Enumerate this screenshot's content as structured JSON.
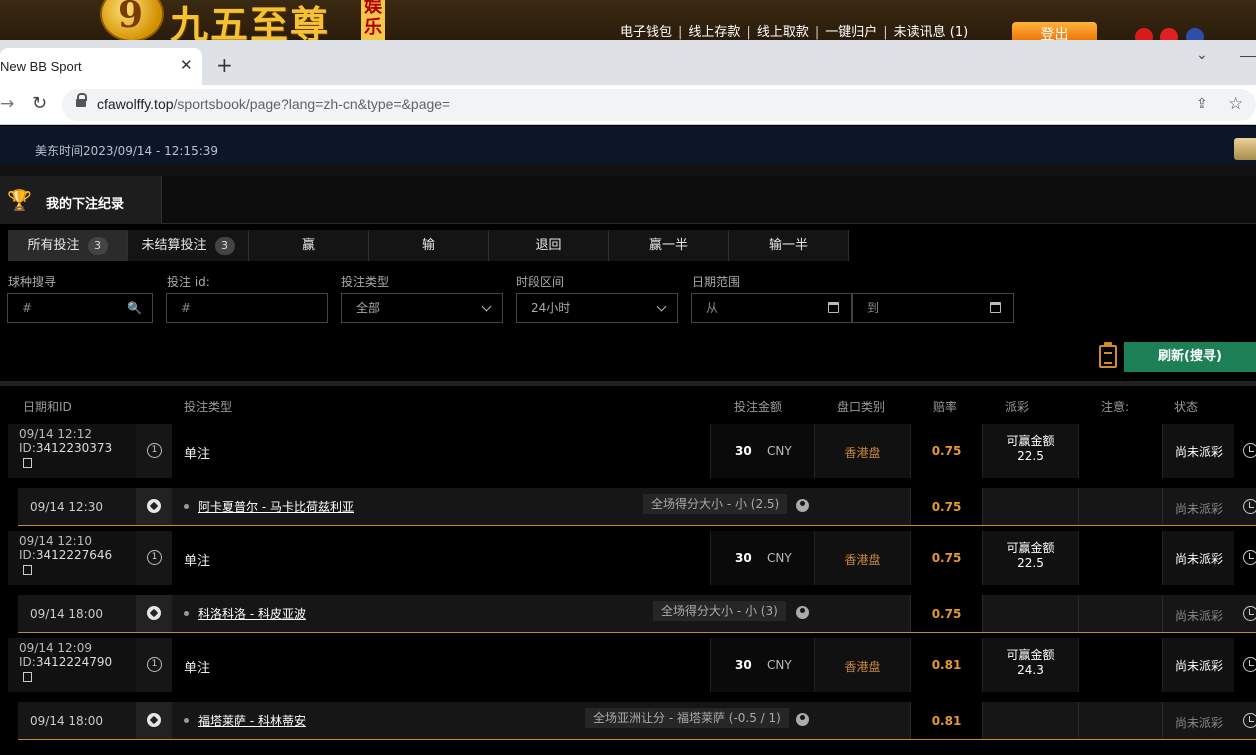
{
  "site": {
    "logo_text": "九五至尊",
    "logo_tag": "娱乐",
    "logo_badge": "9",
    "top_links": [
      "电子钱包",
      "线上存款",
      "线上取款",
      "一键归户",
      "未读讯息 (1)"
    ],
    "logout_label": "登出"
  },
  "browser": {
    "tab_title": "New BB Sport",
    "url_host": "cfawolffy.top",
    "url_path": "/sportsbook/page?lang=zh-cn&type=&page="
  },
  "page": {
    "time_label": "美东时间2023/09/14 - 12:15:39",
    "title": "我的下注纪录",
    "filter_tabs": [
      {
        "label": "所有投注",
        "count": "3"
      },
      {
        "label": "未结算投注",
        "count": "3"
      },
      {
        "label": "赢"
      },
      {
        "label": "输"
      },
      {
        "label": "退回"
      },
      {
        "label": "赢一半"
      },
      {
        "label": "输一半"
      }
    ],
    "filters": {
      "sport_label": "球种搜寻",
      "sport_placeholder": "#",
      "betid_label": "投注 id:",
      "betid_placeholder": "#",
      "bettype_label": "投注类型",
      "bettype_value": "全部",
      "period_label": "时段区间",
      "period_value": "24小时",
      "date_label": "日期范围",
      "date_from": "从",
      "date_to": "到"
    },
    "refresh_label": "刷新(搜寻)",
    "columns": [
      "日期和ID",
      "投注类型",
      "投注金额",
      "盘口类别",
      "赔率",
      "派彩",
      "注意:",
      "状态"
    ]
  },
  "bets": [
    {
      "date": "09/14 12:12",
      "id_prefix": "ID:",
      "id": "3412230373",
      "num": "1",
      "type": "单注",
      "amount": "30",
      "currency": "CNY",
      "market": "香港盘",
      "odds": "0.75",
      "pay_label": "可赢金额",
      "pay_value": "22.5",
      "status": "尚未派彩",
      "sub": {
        "date": "09/14 12:30",
        "match": "阿卡夏普尔 - 马卡比荷兹利亚",
        "pick": "全场得分大小 - 小 (2.5)",
        "odds": "0.75",
        "status": "尚未派彩"
      }
    },
    {
      "date": "09/14 12:10",
      "id_prefix": "ID:",
      "id": "3412227646",
      "num": "1",
      "type": "单注",
      "amount": "30",
      "currency": "CNY",
      "market": "香港盘",
      "odds": "0.75",
      "pay_label": "可赢金额",
      "pay_value": "22.5",
      "status": "尚未派彩",
      "sub": {
        "date": "09/14 18:00",
        "match": "科洛科洛 - 科皮亚波",
        "pick": "全场得分大小 - 小 (3)",
        "odds": "0.75",
        "status": "尚未派彩"
      }
    },
    {
      "date": "09/14 12:09",
      "id_prefix": "ID:",
      "id": "3412224790",
      "num": "1",
      "type": "单注",
      "amount": "30",
      "currency": "CNY",
      "market": "香港盘",
      "odds": "0.81",
      "pay_label": "可赢金额",
      "pay_value": "24.3",
      "status": "尚未派彩",
      "sub": {
        "date": "09/14 18:00",
        "match": "福塔莱萨 - 科林蒂安",
        "pick": "全场亚洲让分 - 福塔莱萨 (-0.5 / 1)",
        "odds": "0.81",
        "status": "尚未派彩"
      }
    }
  ]
}
